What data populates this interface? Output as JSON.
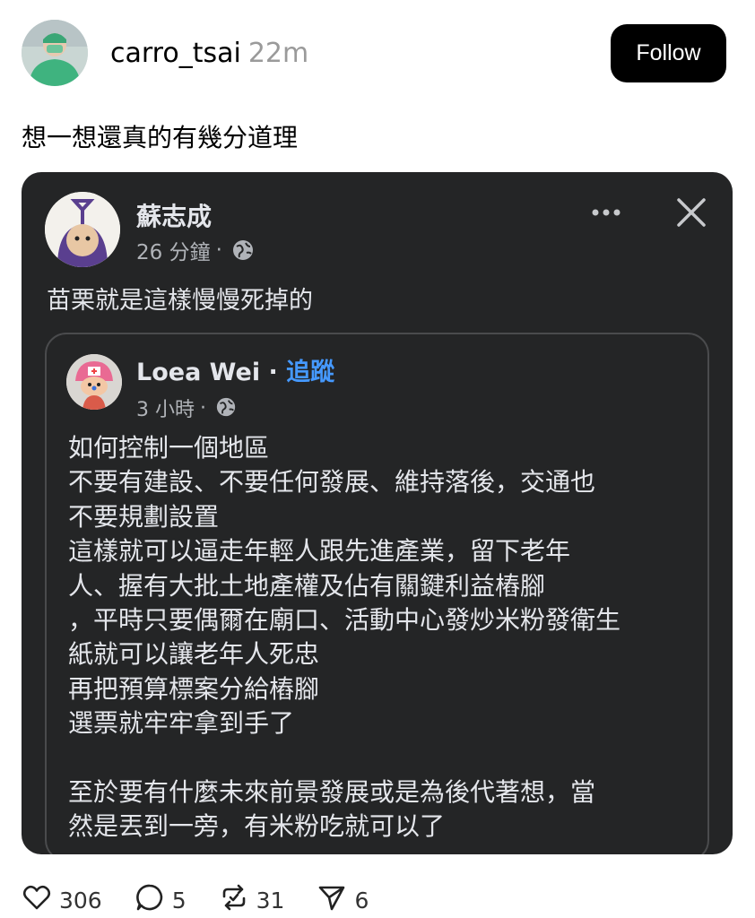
{
  "post": {
    "username": "carro_tsai",
    "time_ago": "22m",
    "follow_label": "Follow",
    "caption": "想一想還真的有幾分道理"
  },
  "embedded_post": {
    "author": "蘇志成",
    "time": "26 分鐘",
    "separator": "·",
    "text": "苗栗就是這樣慢慢死掉的",
    "shared": {
      "author": "Loea Wei",
      "separator": "·",
      "follow_label": "追蹤",
      "time": "3 小時",
      "lines": [
        "如何控制一個地區",
        "不要有建設、不要任何發展、維持落後，交通也",
        "不要規劃設置",
        "這樣就可以逼走年輕人跟先進產業，留下老年",
        "人、握有大批土地產權及佔有關鍵利益樁腳",
        "，平時只要偶爾在廟口、活動中心發炒米粉發衛生",
        "紙就可以讓老年人死忠",
        "再把預算標案分給樁腳",
        "選票就牢牢拿到手了",
        "",
        "至於要有什麼未來前景發展或是為後代著想，當",
        "然是丟到一旁，有米粉吃就可以了"
      ]
    }
  },
  "actions": {
    "likes": "306",
    "comments": "5",
    "reposts": "31",
    "shares": "6"
  },
  "icons": [
    "heart-icon",
    "comment-icon",
    "repost-icon",
    "share-icon",
    "globe-icon",
    "more-icon",
    "close-icon"
  ],
  "colors": {
    "follow_button": "#000000",
    "card_background": "#242526",
    "link_blue": "#4599ff",
    "muted_gray": "#9a9a9a"
  }
}
